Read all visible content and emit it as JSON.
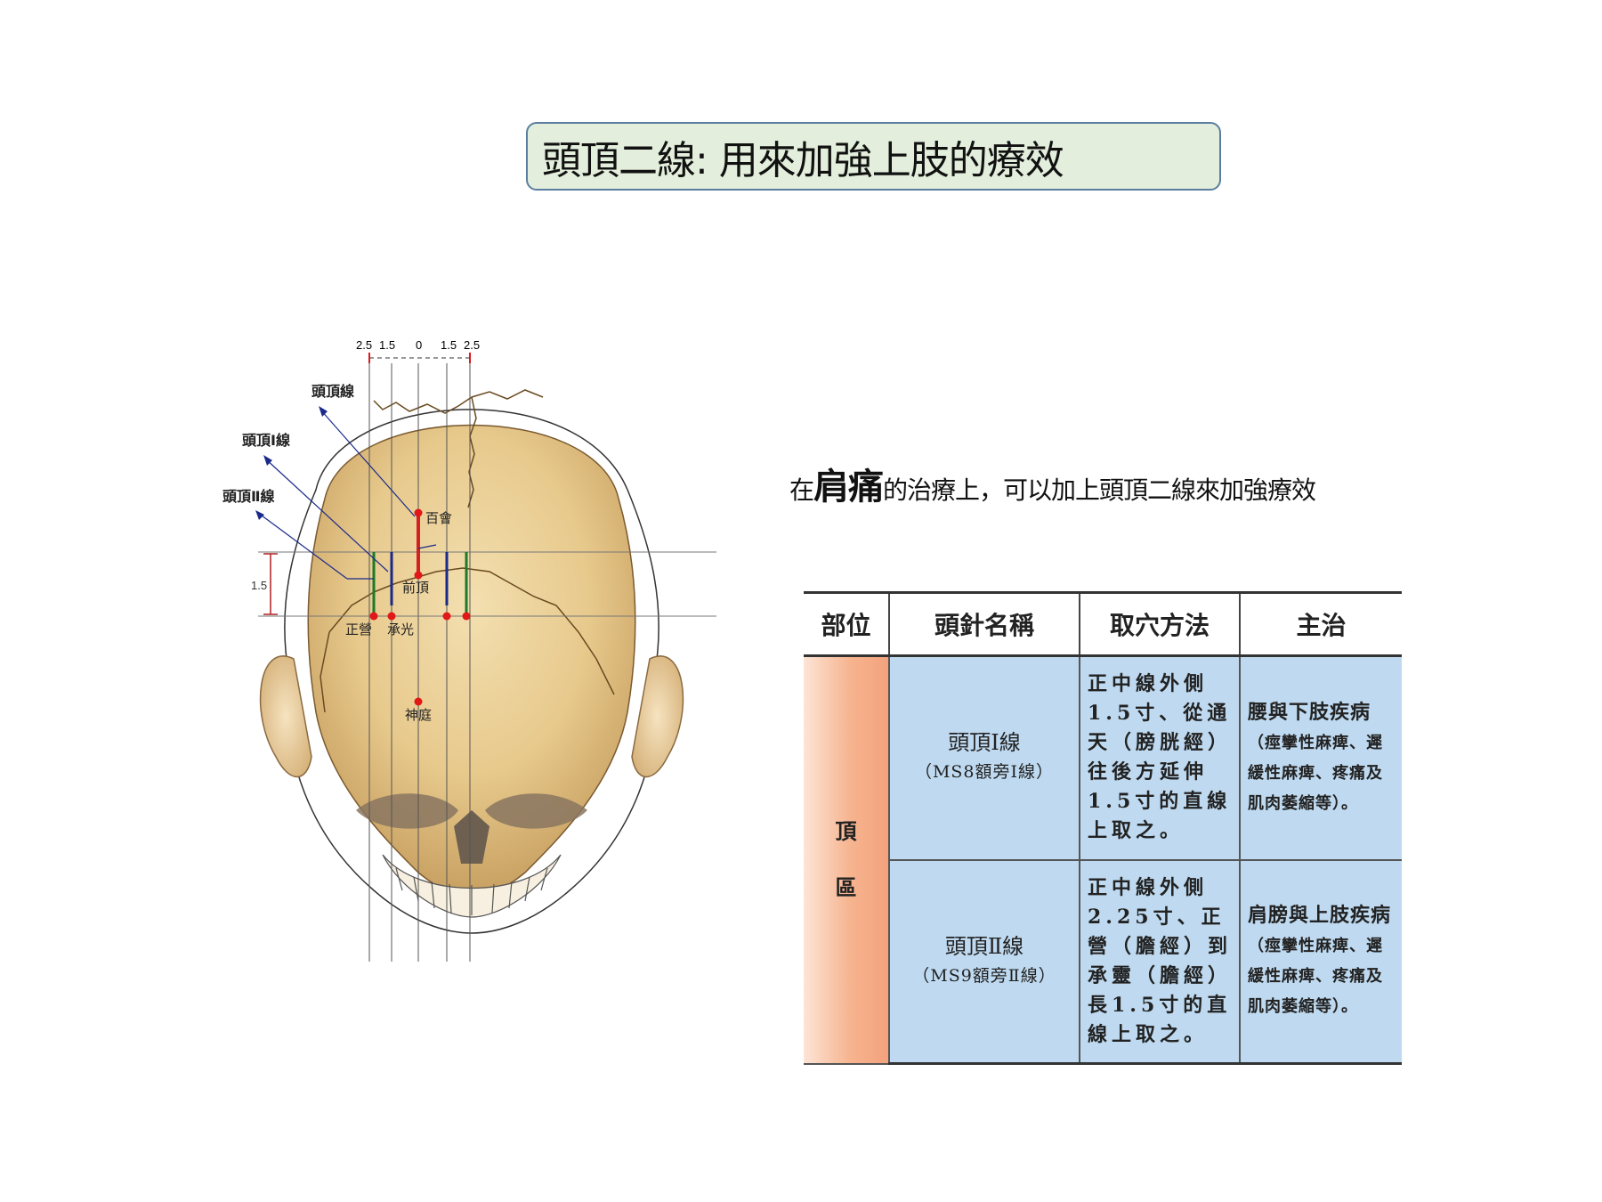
{
  "title": "頭頂二線: 用來加強上肢的療效",
  "note": {
    "prefix": "在",
    "highlight": "肩痛",
    "suffix": "的治療上，可以加上頭頂二線來加強療效"
  },
  "figure": {
    "scale_labels": [
      "2.5",
      "1.5",
      "0",
      "1.5",
      "2.5"
    ],
    "line_labels": {
      "line_main": "頭頂線",
      "line_1": "頭頂Ⅰ線",
      "line_2": "頭頂Ⅱ線"
    },
    "height_label": "1.5",
    "points": {
      "baihui": "百會",
      "qianding": "前頂",
      "zhengying": "正營",
      "chengguang": "承光",
      "shenting": "神庭"
    },
    "colors": {
      "skull": "#e7c98c",
      "midline": "#d42020",
      "line_1": "#1a2a8a",
      "line_2": "#1c7a2a",
      "point": "#e01818"
    }
  },
  "table": {
    "headers": [
      "部位",
      "頭針名稱",
      "取穴方法",
      "主治"
    ],
    "region": [
      "頂",
      "區"
    ],
    "rows": [
      {
        "name": "頭頂Ⅰ線",
        "name_sub": "（MS8額旁Ⅰ線）",
        "method": "正中線外側1.5寸、從通天（膀胱經）往後方延伸1.5寸的直線上取之。",
        "treat_main": "腰與下肢疾病",
        "treat_detail": "（痙攣性麻痺、遲緩性麻痺、疼痛及肌肉萎縮等）。"
      },
      {
        "name": "頭頂Ⅱ線",
        "name_sub": "（MS9額旁Ⅱ線）",
        "method": "正中線外側2.25寸、正營（膽經）到承靈（膽經）長1.5寸的直線上取之。",
        "treat_main": "肩膀與上肢疾病",
        "treat_detail": "（痙攣性麻痺、遲緩性麻痺、疼痛及肌肉萎縮等）。"
      }
    ]
  }
}
